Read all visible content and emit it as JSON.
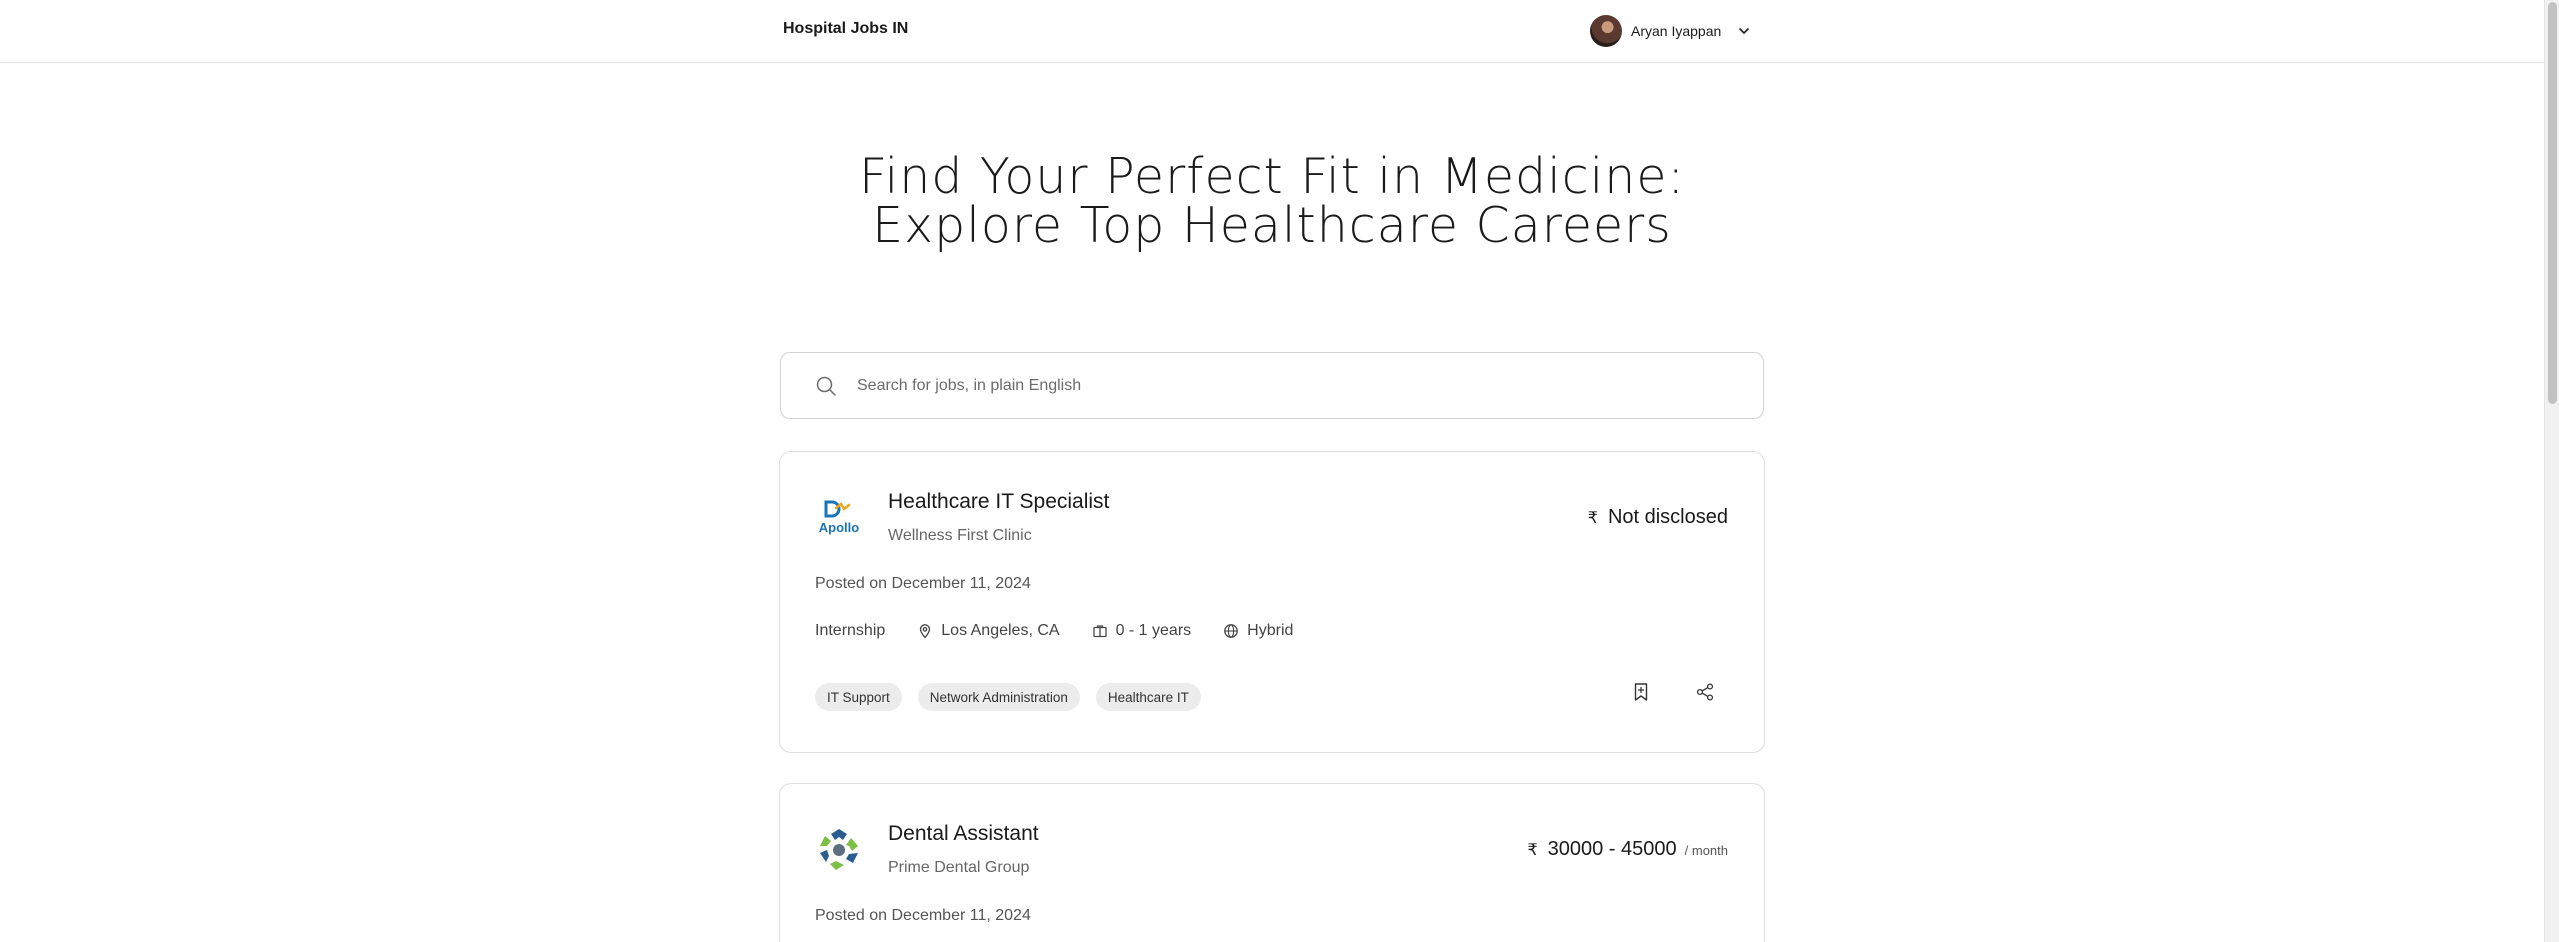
{
  "header": {
    "brand": "Hospital Jobs IN",
    "user_name": "Aryan Iyappan"
  },
  "hero": {
    "line1": "Find Your Perfect Fit in Medicine:",
    "line2": "Explore Top Healthcare Careers"
  },
  "search": {
    "placeholder": "Search for jobs, in plain English",
    "value": ""
  },
  "jobs": [
    {
      "title": "Healthcare IT Specialist",
      "company": "Wellness First Clinic",
      "currency": "₹",
      "salary": "Not disclosed",
      "posted": "Posted on December 11, 2024",
      "type": "Internship",
      "location": "Los Angeles, CA",
      "experience": "0 - 1 years",
      "mode": "Hybrid",
      "tags": [
        "IT Support",
        "Network Administration",
        "Healthcare IT"
      ],
      "logo_text": "Apollo"
    },
    {
      "title": "Dental Assistant",
      "company": "Prime Dental Group",
      "currency": "₹",
      "salary": "30000 - 45000",
      "salary_period": "/ month",
      "posted": "Posted on December 11, 2024"
    }
  ],
  "colors": {
    "border": "#dedede",
    "tag_bg": "#ececec",
    "apollo_blue": "#1a74b8",
    "apollo_orange": "#f3a51c"
  },
  "icons": [
    "search-icon",
    "chevron-down-icon",
    "location-pin-icon",
    "briefcase-icon",
    "globe-icon",
    "bookmark-icon",
    "share-icon"
  ]
}
